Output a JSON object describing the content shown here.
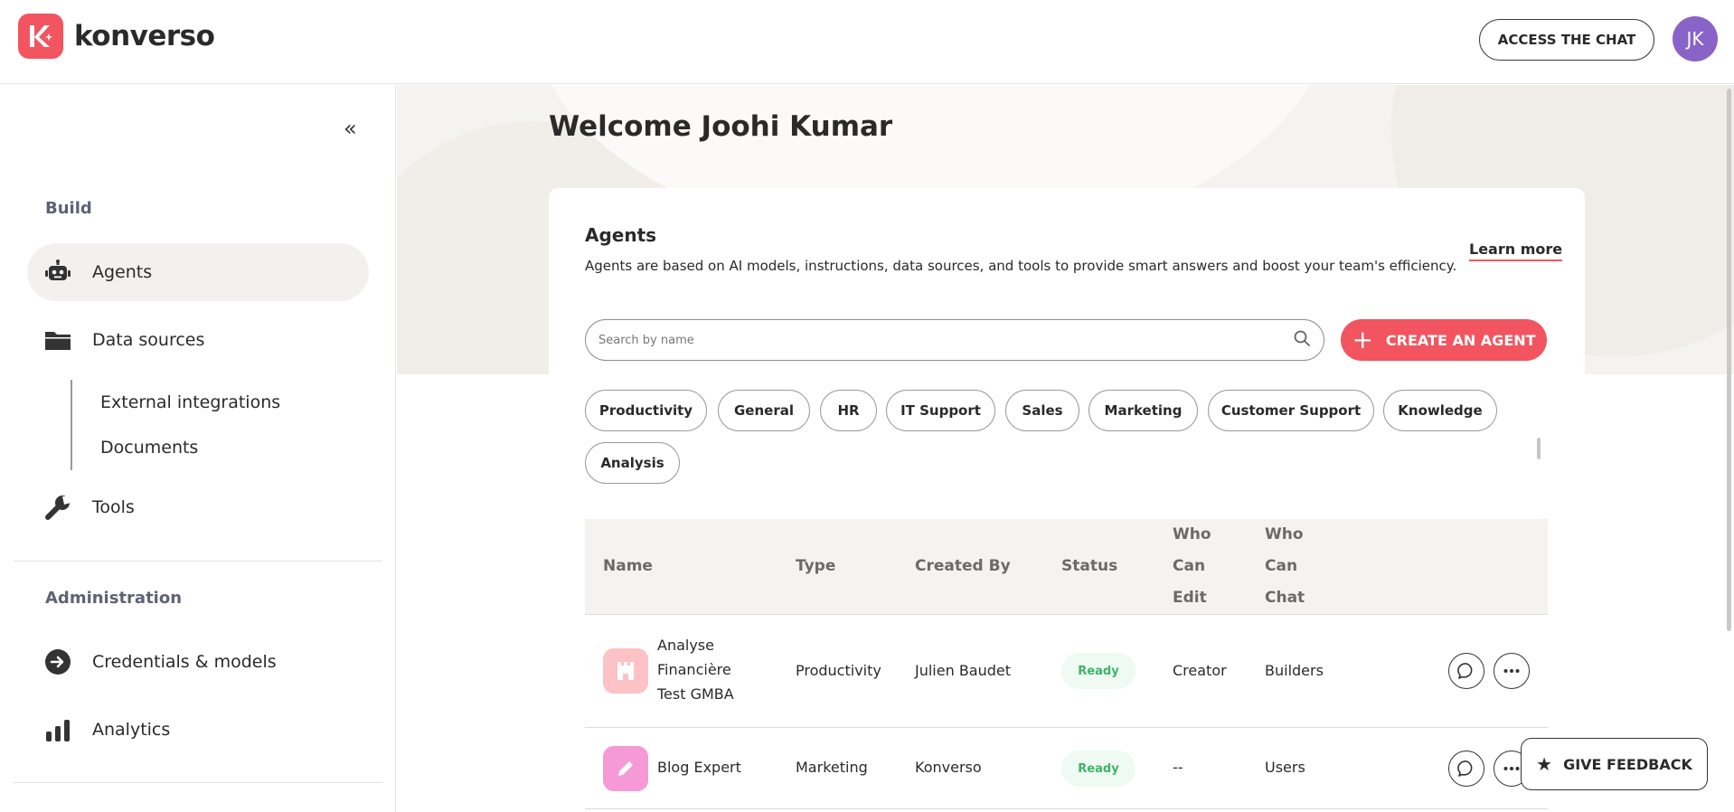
{
  "brand": {
    "name": "konverso",
    "accent": "#f2555f"
  },
  "header": {
    "access_chat_label": "ACCESS THE CHAT",
    "avatar_initials": "JK"
  },
  "sidebar": {
    "collapse_glyph": "«",
    "build_title": "Build",
    "items": [
      {
        "label": "Agents",
        "icon": "robot-icon"
      },
      {
        "label": "Data sources",
        "icon": "folder-icon"
      },
      {
        "label": "Tools",
        "icon": "wrench-icon"
      }
    ],
    "sub_items": [
      {
        "label": "External integrations"
      },
      {
        "label": "Documents"
      }
    ],
    "administration_title": "Administration",
    "admin_items": [
      {
        "label": "Credentials & models",
        "icon": "login-arrow-icon"
      },
      {
        "label": "Analytics",
        "icon": "bar-chart-icon"
      }
    ]
  },
  "main": {
    "welcome": "Welcome Joohi Kumar",
    "agents_title": "Agents",
    "agents_description": "Agents are based on AI models, instructions, data sources, and tools to provide smart answers and boost your team's efficiency.",
    "learn_more": "Learn more",
    "search_placeholder": "Search by name",
    "create_label": "CREATE AN AGENT",
    "categories": [
      "Productivity",
      "General",
      "HR",
      "IT Support",
      "Sales",
      "Marketing",
      "Customer Support",
      "Knowledge",
      "Analysis"
    ]
  },
  "table": {
    "headers": {
      "name": "Name",
      "type": "Type",
      "created_by": "Created By",
      "status": "Status",
      "who_can_edit": [
        "Who",
        "Can",
        "Edit"
      ],
      "who_can_chat": [
        "Who",
        "Can",
        "Chat"
      ]
    },
    "rows": [
      {
        "name_lines": [
          "Analyse",
          "Financière",
          "Test GMBA"
        ],
        "type": "Productivity",
        "created_by": "Julien Baudet",
        "status": "Ready",
        "who_can_edit": "Creator",
        "who_can_chat": "Builders",
        "icon": "castle-icon",
        "icon_color": "#fcc2c6"
      },
      {
        "name_lines": [
          "Blog Expert"
        ],
        "type": "Marketing",
        "created_by": "Konverso",
        "status": "Ready",
        "who_can_edit": "--",
        "who_can_chat": "Users",
        "icon": "pencil-icon",
        "icon_color": "#f59ad6"
      }
    ]
  },
  "feedback_label": "GIVE FEEDBACK"
}
